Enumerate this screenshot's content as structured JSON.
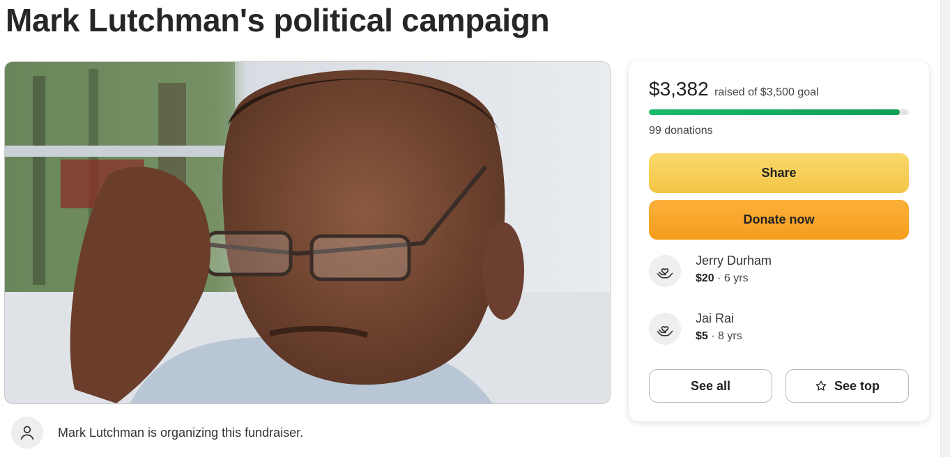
{
  "title": "Mark Lutchman's political campaign",
  "organizer": {
    "text": "Mark Lutchman is organizing this fundraiser.",
    "icon": "user-icon"
  },
  "photo": {
    "icon": "campaign-photo"
  },
  "donation_card": {
    "raised": "$3,382",
    "goal_text": "raised of $3,500 goal",
    "progress": 0.966,
    "donations": "99 donations",
    "share_label": "Share",
    "donate_label": "Donate now",
    "donors": [
      {
        "name": "Jerry Durham",
        "amount": "$20",
        "time": " · 6 yrs",
        "icon": "heart-hand-icon"
      },
      {
        "name": "Jai Rai",
        "amount": "$5",
        "time": " · 8 yrs",
        "icon": "heart-hand-icon"
      }
    ],
    "see_all_label": "See all",
    "see_top_label": "See top"
  },
  "colors": {
    "progress": "#0e9e57",
    "share_button": "#f3c546",
    "donate_button": "#f59d1c"
  }
}
